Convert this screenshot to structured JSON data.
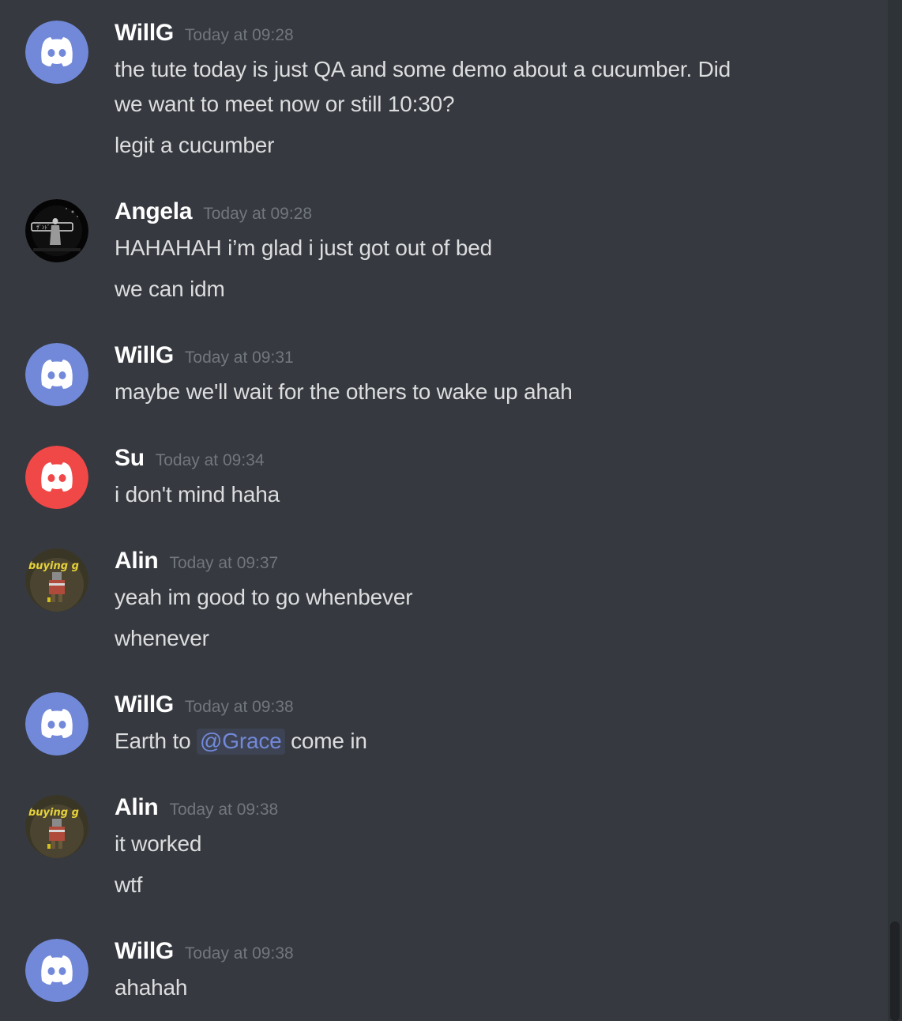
{
  "colors": {
    "background": "#36393f",
    "blurple": "#7289da",
    "red": "#f04747",
    "timestamp": "#72767d",
    "text": "#dcddde"
  },
  "messages": [
    {
      "username": "WillG",
      "timestamp": "Today at 09:28",
      "avatar": "discord-blurple-icon",
      "lines": [
        "the tute today is just QA and some demo about a cucumber. Did",
        "we want to meet now or still 10:30?",
        "legit a cucumber"
      ]
    },
    {
      "username": "Angela",
      "timestamp": "Today at 09:28",
      "avatar": "angela-photo",
      "lines": [
        "HAHAHAH i’m glad i just got out of bed",
        "we can idm"
      ]
    },
    {
      "username": "WillG",
      "timestamp": "Today at 09:31",
      "avatar": "discord-blurple-icon",
      "lines": [
        "maybe we'll wait for the others to wake up ahah"
      ]
    },
    {
      "username": "Su",
      "timestamp": "Today at 09:34",
      "avatar": "discord-red-icon",
      "lines": [
        "i don't mind haha"
      ]
    },
    {
      "username": "Alin",
      "timestamp": "Today at 09:37",
      "avatar": "alin-game-image",
      "avatar_text": "buying g",
      "lines": [
        "yeah im good to go whenbever",
        "whenever"
      ]
    },
    {
      "username": "WillG",
      "timestamp": "Today at 09:38",
      "avatar": "discord-blurple-icon",
      "mention_line": {
        "before": "Earth to ",
        "mention": "@Grace",
        "after": " come in"
      }
    },
    {
      "username": "Alin",
      "timestamp": "Today at 09:38",
      "avatar": "alin-game-image",
      "avatar_text": "buying g",
      "lines": [
        "it worked",
        "wtf"
      ]
    },
    {
      "username": "WillG",
      "timestamp": "Today at 09:38",
      "avatar": "discord-blurple-icon",
      "lines": [
        "ahahah"
      ]
    }
  ]
}
